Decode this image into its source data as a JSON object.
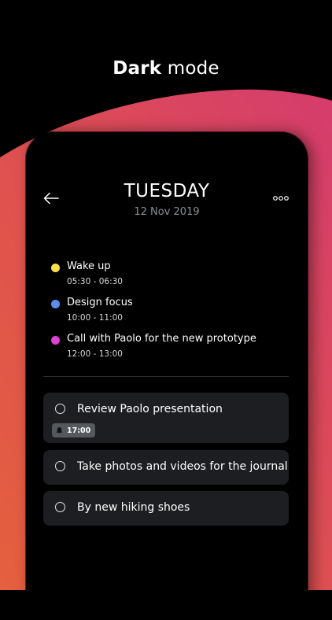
{
  "headline": {
    "bold": "Dark",
    "rest": " mode"
  },
  "screen": {
    "day": "TUESDAY",
    "date": "12 Nov 2019"
  },
  "events": [
    {
      "name": "Wake up",
      "time": "05:30 - 06:30",
      "color": "#f7e14a"
    },
    {
      "name": "Design focus",
      "time": "10:00 - 11:00",
      "color": "#5b8def"
    },
    {
      "name": "Call with Paolo for the new prototype",
      "time": "12:00 - 13:00",
      "color": "#e040d6"
    }
  ],
  "tasks": [
    {
      "label": "Review Paolo presentation",
      "reminder": "17:00"
    },
    {
      "label": "Take photos and videos for the journal"
    },
    {
      "label": "By new hiking shoes"
    }
  ],
  "colors": {
    "background": "#000000",
    "card": "#1c1e21",
    "gradient_top": "#d6406b",
    "gradient_bottom": "#e25a42"
  },
  "icons": [
    "back-arrow-icon",
    "more-options-icon",
    "bell-icon",
    "circle-checkbox-icon"
  ]
}
